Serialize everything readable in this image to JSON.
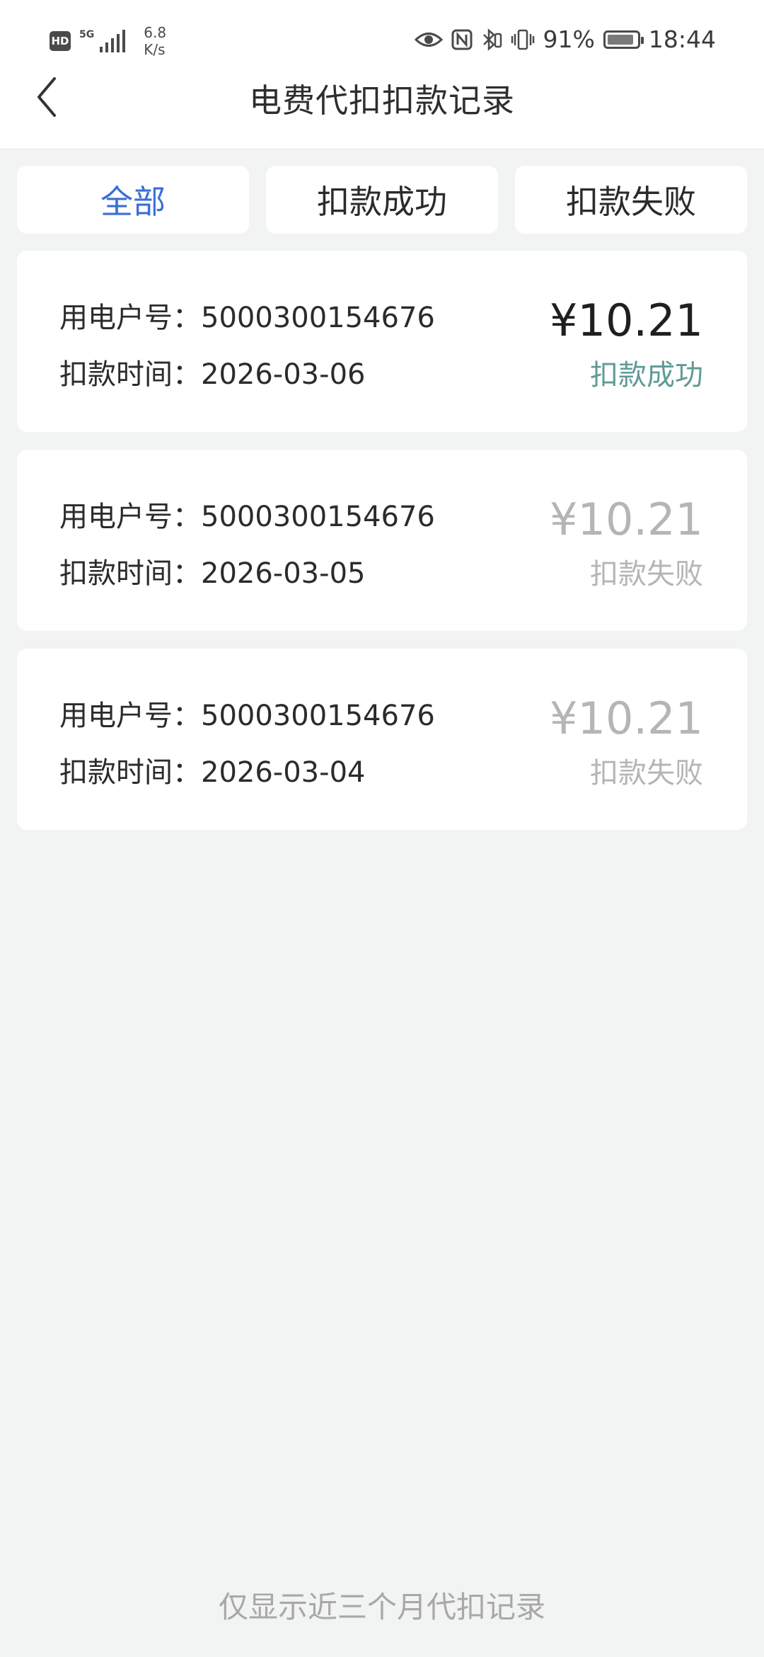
{
  "status_bar": {
    "hd_label": "HD",
    "network_label": "5G",
    "net_speed_value": "6.8",
    "net_speed_unit": "K/s",
    "battery_percent": "91%",
    "battery_level": 0.91,
    "time": "18:44",
    "icons": [
      "eye-icon",
      "nfc-icon",
      "bluetooth-icon",
      "vibrate-icon",
      "battery-icon"
    ]
  },
  "header": {
    "title": "电费代扣扣款记录",
    "back_icon": "chevron-left-icon"
  },
  "tabs": [
    {
      "label": "全部",
      "active": true
    },
    {
      "label": "扣款成功",
      "active": false
    },
    {
      "label": "扣款失败",
      "active": false
    }
  ],
  "records": [
    {
      "account_label": "用电户号：",
      "account": "5000300154676",
      "time_label": "扣款时间：",
      "time": "2026-03-06",
      "amount": "¥10.21",
      "status": "扣款成功",
      "state": "success"
    },
    {
      "account_label": "用电户号：",
      "account": "5000300154676",
      "time_label": "扣款时间：",
      "time": "2026-03-05",
      "amount": "¥10.21",
      "status": "扣款失败",
      "state": "failed"
    },
    {
      "account_label": "用电户号：",
      "account": "5000300154676",
      "time_label": "扣款时间：",
      "time": "2026-03-04",
      "amount": "¥10.21",
      "status": "扣款失败",
      "state": "failed"
    }
  ],
  "footer": {
    "note": "仅显示近三个月代扣记录"
  },
  "colors": {
    "accent": "#3a6fd6",
    "success": "#5f9b97",
    "muted": "#b5b5b5",
    "background": "#f2f3f3"
  }
}
